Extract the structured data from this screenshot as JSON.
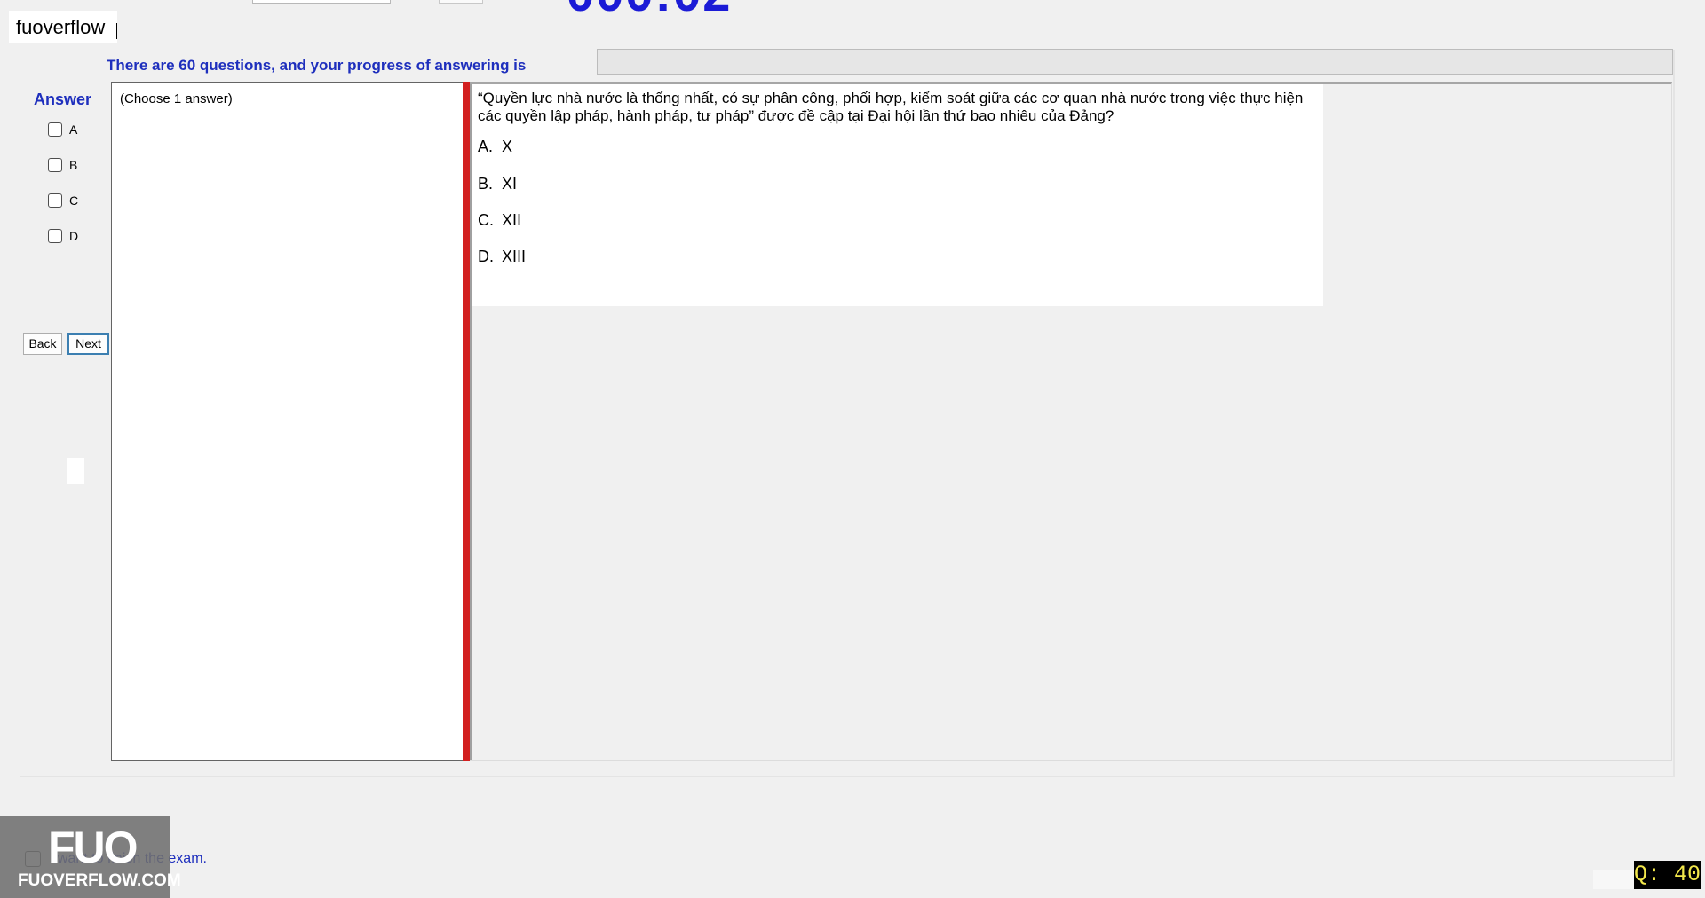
{
  "watermark_tag": "fuoverflow",
  "progress": {
    "label": "There are 60 questions, and your progress of answering is",
    "fraction": 0.0,
    "fill_color": "#06b025"
  },
  "answer_panel": {
    "title": "Answer",
    "options": [
      "A",
      "B",
      "C",
      "D"
    ]
  },
  "nav": {
    "back": "Back",
    "next": "Next"
  },
  "left_box": {
    "hint": "(Choose 1 answer)"
  },
  "question": {
    "text": "“Quyền lực nhà nước là thống nhất, có sự phân công, phối hợp, kiểm soát giữa các cơ quan nhà nước trong việc thực hiện các quyền lập pháp, hành pháp, tư pháp” được đề cập tại Đại hội lần thứ bao nhiêu của Đảng?",
    "choices": [
      {
        "letter": "A.",
        "text": "X"
      },
      {
        "letter": "B.",
        "text": "XI"
      },
      {
        "letter": "C.",
        "text": "XII"
      },
      {
        "letter": "D.",
        "text": "XIII"
      }
    ]
  },
  "finish": {
    "label": "I want to finish the exam."
  },
  "logo": {
    "big": "FUO",
    "small": "FUOVERFLOW.COM"
  },
  "question_badge": "Q: 40",
  "colors": {
    "accent_blue": "#1e2fbd",
    "splitter_red": "#d21f1f",
    "timer_blue": "#1b1bd6"
  }
}
